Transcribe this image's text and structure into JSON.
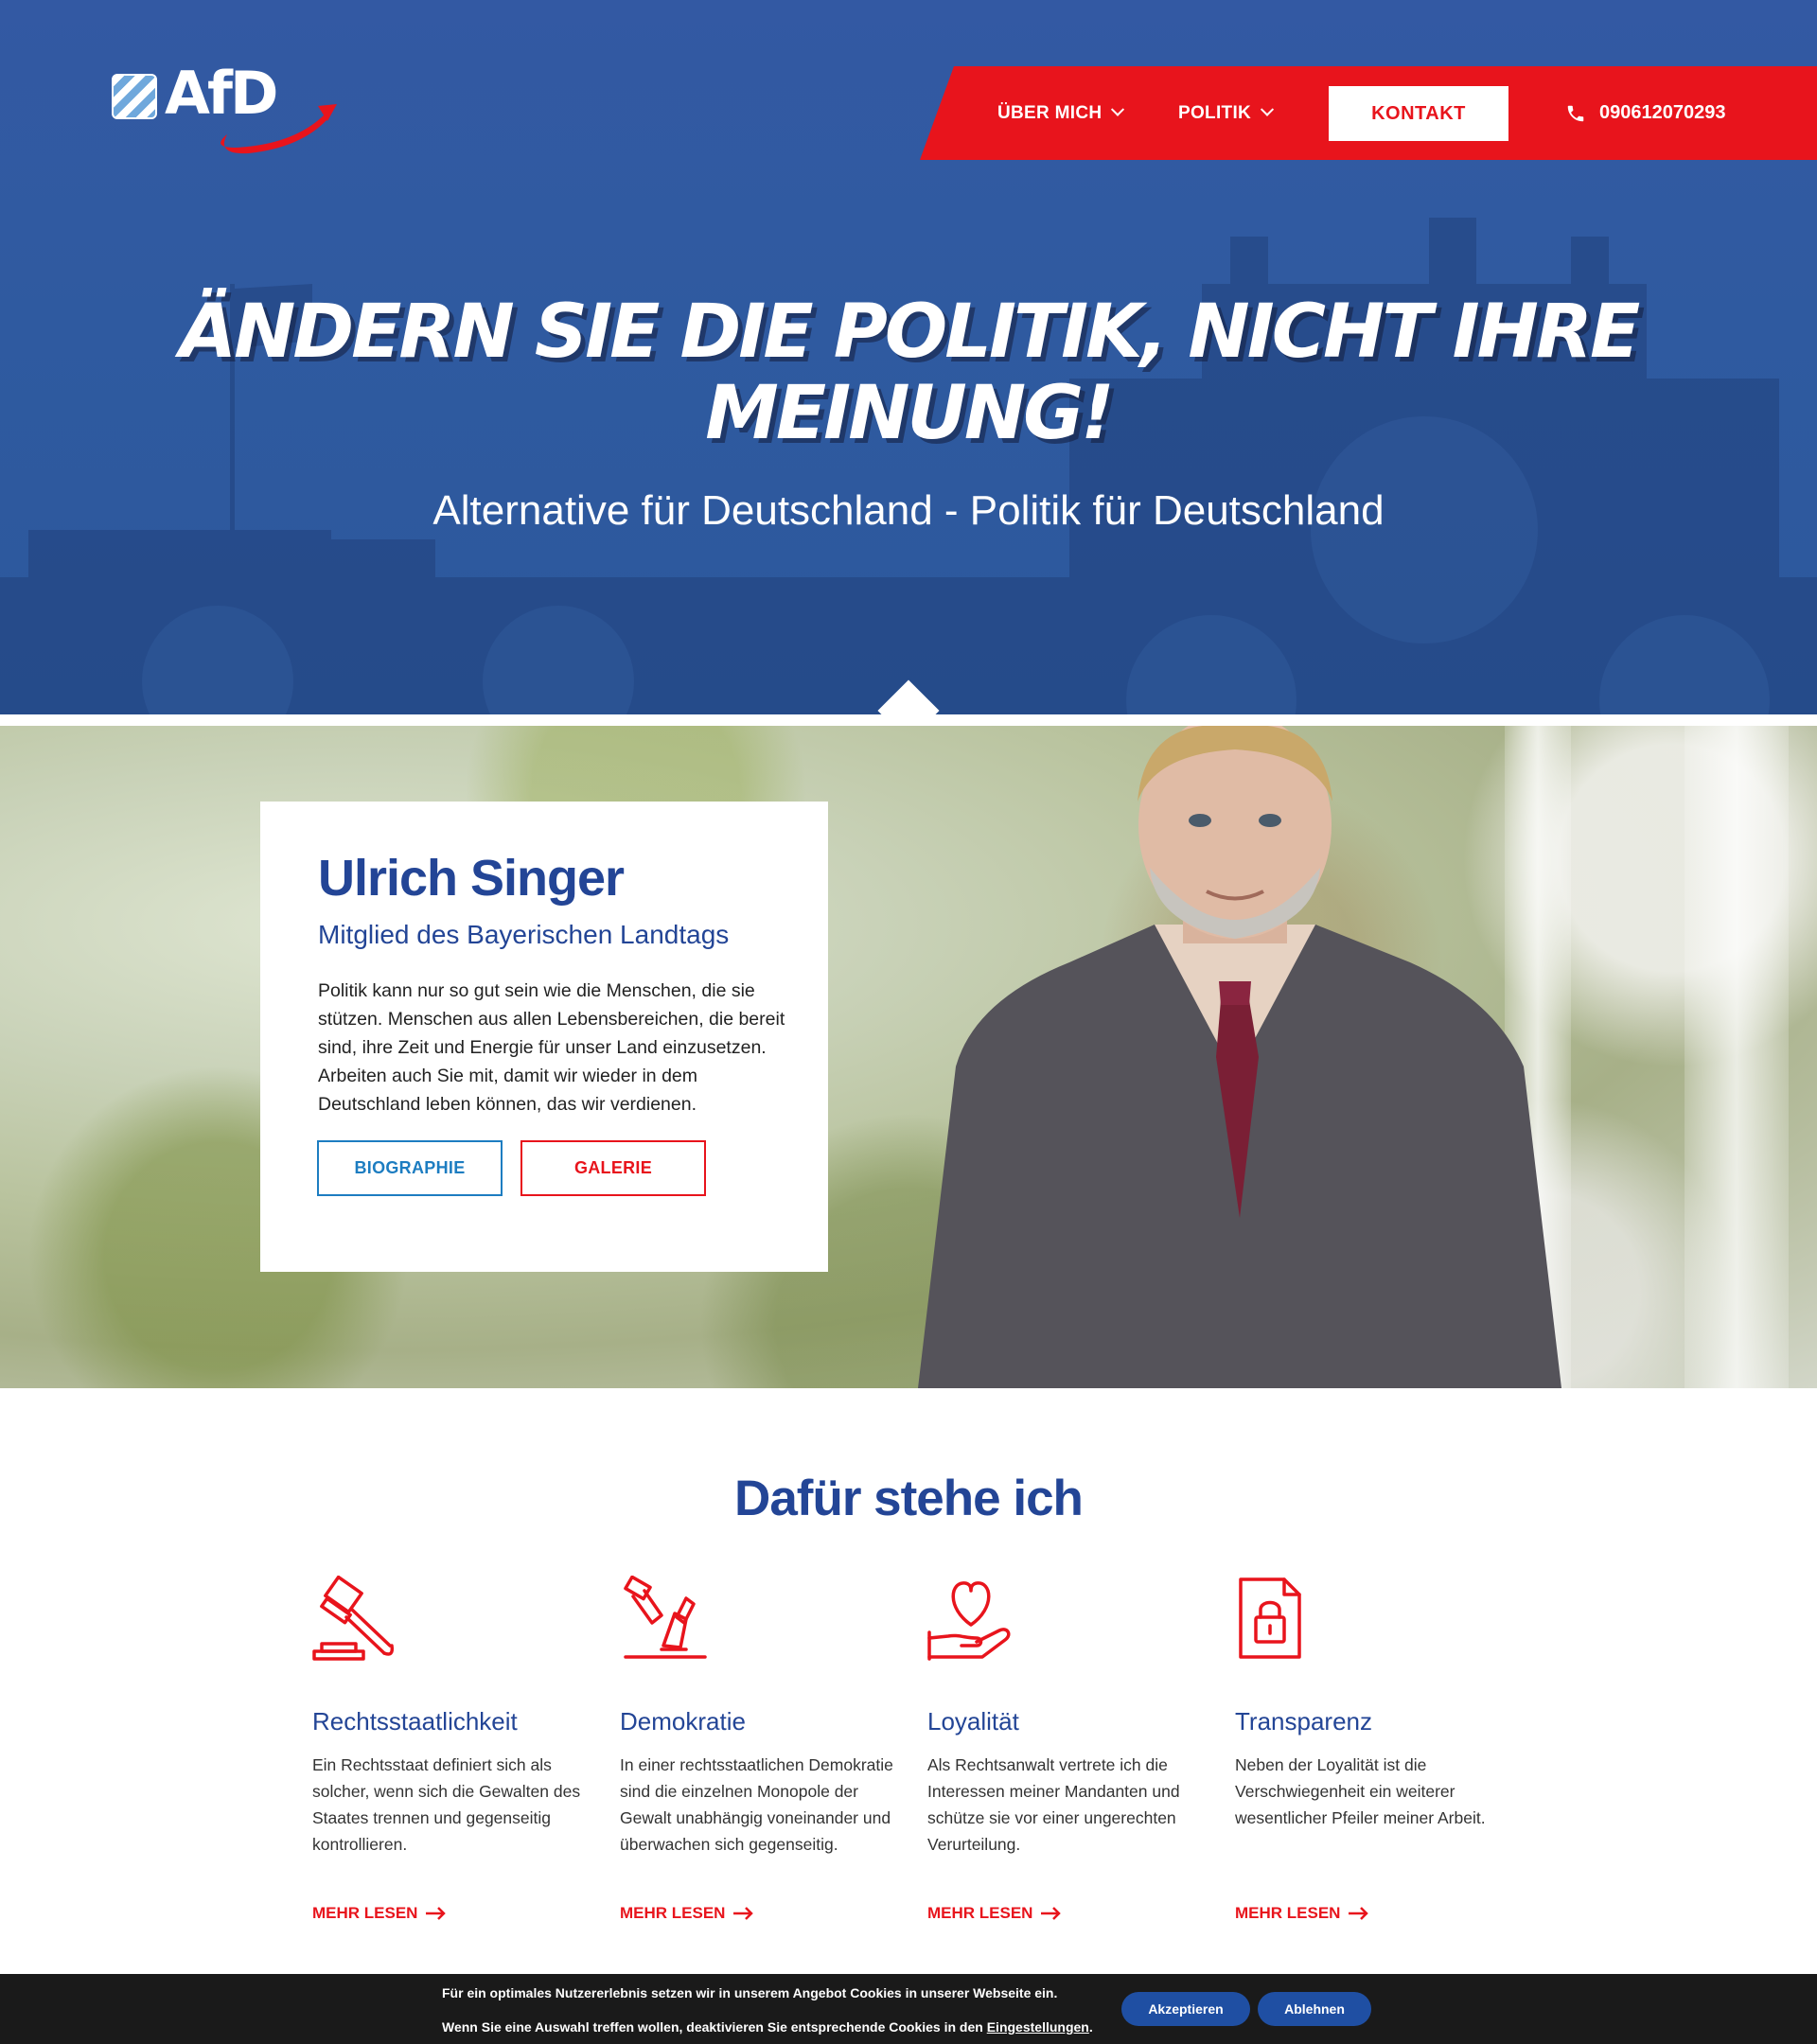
{
  "brand": {
    "logo_text": "AfD"
  },
  "nav": {
    "items": [
      {
        "label": "ÜBER MICH"
      },
      {
        "label": "POLITIK"
      }
    ],
    "cta_label": "KONTAKT",
    "phone": "090612070293"
  },
  "hero": {
    "title_line1": "ÄNDERN SIE DIE POLITIK,  NICHT IHRE",
    "title_line2": "MEINUNG!",
    "subtitle": "Alternative für Deutschland - Politik für Deutschland"
  },
  "profile": {
    "name": "Ulrich Singer",
    "role": "Mitglied des Bayerischen Landtags",
    "text": "Politik kann nur so gut sein wie die Menschen, die sie stützen. Menschen aus allen Lebensbereichen, die bereit sind, ihre Zeit und Energie für unser Land einzusetzen. Arbeiten auch Sie mit, damit wir wieder in dem Deutschland leben können, das wir verdienen.",
    "buttons": {
      "bio": "BIOGRAPHIE",
      "gallery": "GALERIE"
    }
  },
  "values": {
    "title": "Dafür stehe ich",
    "items": [
      {
        "icon": "gavel-icon",
        "title": "Rechtsstaatlichkeit",
        "text": "Ein Rechtsstaat definiert sich als solcher, wenn sich die Gewalten des Staates trennen und gegenseitig kontrollieren.",
        "more": "MEHR LESEN"
      },
      {
        "icon": "vote-icon",
        "title": "Demokratie",
        "text": "In einer rechtsstaatlichen Demokratie sind die einzelnen Monopole der Gewalt unabhängig voneinander und überwachen sich gegenseitig.",
        "more": "MEHR LESEN"
      },
      {
        "icon": "heart-hand-icon",
        "title": "Loyalität",
        "text": "Als Rechtsanwalt vertrete ich die Interessen meiner Mandanten und schütze sie vor einer ungerechten Verurteilung.",
        "more": "MEHR LESEN"
      },
      {
        "icon": "locked-document-icon",
        "title": "Transparenz",
        "text": "Neben der Loyalität ist die Verschwiegenheit ein weiterer wesentlicher Pfeiler meiner Arbeit.",
        "more": "MEHR LESEN"
      }
    ]
  },
  "cookie": {
    "line1": "Für ein optimales Nutzererlebnis setzen wir in unserem Angebot Cookies in unserer Webseite ein.",
    "line2": "Wenn Sie eine Auswahl treffen wollen, deaktivieren Sie entsprechende Cookies in den",
    "link": "Eingestellungen",
    "line2_end": ".",
    "accept": "Akzeptieren",
    "decline": "Ablehnen"
  },
  "colors": {
    "primary_blue": "#234596",
    "hero_blue": "#2f5aa0",
    "accent_red": "#e8141c",
    "link_blue": "#1d7dc1"
  }
}
